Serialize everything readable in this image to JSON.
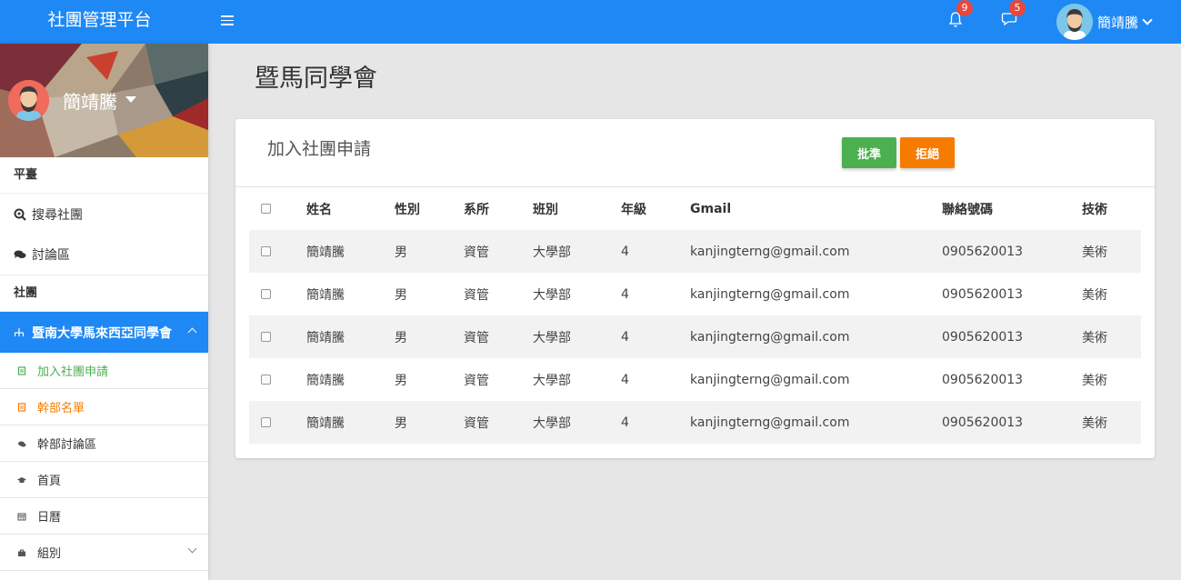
{
  "topbar": {
    "brand": "社團管理平台",
    "notifications_count": "9",
    "messages_count": "5",
    "user_name": "簡靖騰"
  },
  "sidebar": {
    "profile_name": "簡靖騰",
    "section_platform": "平臺",
    "search_clubs": "搜尋社團",
    "discussion": "討論區",
    "section_clubs": "社團",
    "club_group": "暨南大學馬來西亞同學會",
    "sub_items": [
      {
        "label": "加入社團申請",
        "color": "#4caf50"
      },
      {
        "label": "幹部名單",
        "color": "#f57c00"
      },
      {
        "label": "幹部討論區",
        "color": "#333333"
      },
      {
        "label": "首頁",
        "color": "#333333"
      },
      {
        "label": "日曆",
        "color": "#333333"
      },
      {
        "label": "組別",
        "color": "#333333"
      }
    ]
  },
  "main": {
    "page_title": "暨馬同學會",
    "card_title": "加入社團申請",
    "approve_label": "批準",
    "reject_label": "拒絕",
    "columns": [
      "姓名",
      "性別",
      "系所",
      "班別",
      "年級",
      "Gmail",
      "聯絡號碼",
      "技術"
    ],
    "rows": [
      [
        "簡靖騰",
        "男",
        "資管",
        "大學部",
        "4",
        "kanjingterng@gmail.com",
        "0905620013",
        "美術"
      ],
      [
        "簡靖騰",
        "男",
        "資管",
        "大學部",
        "4",
        "kanjingterng@gmail.com",
        "0905620013",
        "美術"
      ],
      [
        "簡靖騰",
        "男",
        "資管",
        "大學部",
        "4",
        "kanjingterng@gmail.com",
        "0905620013",
        "美術"
      ],
      [
        "簡靖騰",
        "男",
        "資管",
        "大學部",
        "4",
        "kanjingterng@gmail.com",
        "0905620013",
        "美術"
      ],
      [
        "簡靖騰",
        "男",
        "資管",
        "大學部",
        "4",
        "kanjingterng@gmail.com",
        "0905620013",
        "美術"
      ]
    ]
  },
  "colors": {
    "primary": "#1e88f5",
    "approve": "#4caf50",
    "reject": "#f57c00",
    "badge": "#e8473d"
  }
}
